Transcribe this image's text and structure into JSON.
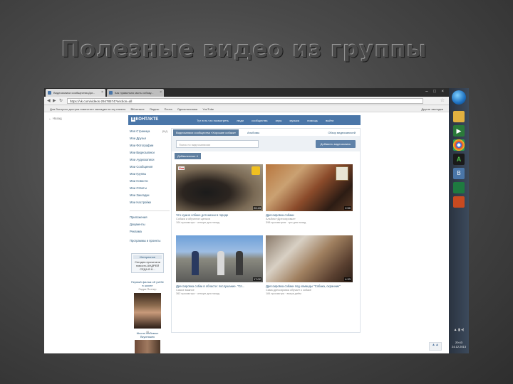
{
  "slide_title": "Полезные видео из группы",
  "browser": {
    "tabs": [
      {
        "label": "Видеозаписи сообщества Дог..."
      },
      {
        "label": "Как правильно мыть собаку..."
      }
    ],
    "new_tab": "",
    "tab_close": "×",
    "window_controls": "–  □  ×",
    "back_icon": "◀",
    "forward_icon": "▶",
    "reload_icon": "↻",
    "url": "https://vk.com/videos-29478574?section=all",
    "bookmark_star": "☆",
    "bookmarks": [
      "Для быстрого доступа поместите закладки на эту панель",
      "ВКонтакте",
      "Яндекс",
      "Почта",
      "Одноклассники",
      "YouTube"
    ],
    "other_bookmarks": "Другие закладки"
  },
  "vk": {
    "back_link": "← Назад",
    "logo_badge": "В",
    "logo_text": "КОНТАКТЕ",
    "header_links": [
      "Тут есть что посмотреть",
      "люди",
      "сообщества",
      "игры",
      "музыка",
      "помощь",
      "выйти"
    ],
    "left_menu": [
      {
        "label": "Моя Страница",
        "count": "ред."
      },
      {
        "label": "Мои Друзья",
        "count": ""
      },
      {
        "label": "Мои Фотографии",
        "count": ""
      },
      {
        "label": "Мои Видеозаписи",
        "count": ""
      },
      {
        "label": "Мои Аудиозаписи",
        "count": ""
      },
      {
        "label": "Мои Сообщения",
        "count": ""
      },
      {
        "label": "Мои Группы",
        "count": ""
      },
      {
        "label": "Мои Новости",
        "count": ""
      },
      {
        "label": "Мои Ответы",
        "count": ""
      },
      {
        "label": "Мои Закладки",
        "count": ""
      },
      {
        "label": "Мои Настройки",
        "count": ""
      }
    ],
    "left_menu_more": [
      "Приложения",
      "Документы",
      "Реклама"
    ],
    "left_menu_misc": "Программы и проекты",
    "ad1": {
      "header": "Интересное",
      "text": "Сегодня прочитали новость АНДРЕЙ СЕДА В К..."
    },
    "ad2": {
      "text": "Первый фильм об учёбе в школе",
      "sub": "Гарри Поттер",
      "count": "46"
    },
    "ad3": {
      "text": "Школа любимых Вкусняшек"
    },
    "video_tabs": {
      "active": "Видеозаписи сообщества «Хорошие собаки»",
      "second": "Альбомы",
      "right": "Обзор видеозаписей"
    },
    "search_placeholder": "Поиск по видеозаписям",
    "add_button": "Добавить видеозапись",
    "subhead_active": "Добавленные 4",
    "videos": [
      {
        "title": "Что нужно собаке для жизни в городе",
        "meta": "Собаки и обучение щенков",
        "meta2": "104 просмотра · четыре дня назад",
        "duration": "20:43"
      },
      {
        "title": "Дрессировка собаки",
        "meta": "Альбом «Дрессировка»",
        "meta2": "398 просмотров · три дня назад",
        "duration": "2:50"
      },
      {
        "title": "Дрессировка собак в области: послушание. \"Сп...",
        "meta": "Самое важное",
        "meta2": "362 просмотра · четыре дня назад",
        "duration": "17:02"
      },
      {
        "title": "Дрессировка собаки под команды \"Собака, охранник\"",
        "meta": "Сама дрессировка обучает к собаке",
        "meta2": "184 просмотра · вчера днём",
        "duration": "4:33"
      }
    ],
    "scroll_top": "▲▲"
  },
  "taskbar": {
    "icons": [
      "folder",
      "media",
      "chrome",
      "app-a",
      "vk",
      "excel",
      "powerpoint"
    ],
    "clock_time": "20:43",
    "clock_date": "24.12.2013"
  },
  "colors": {
    "vk_blue": "#4a76a8",
    "vk_link": "#2b587a",
    "slide_bg": "#4a4a4a"
  }
}
